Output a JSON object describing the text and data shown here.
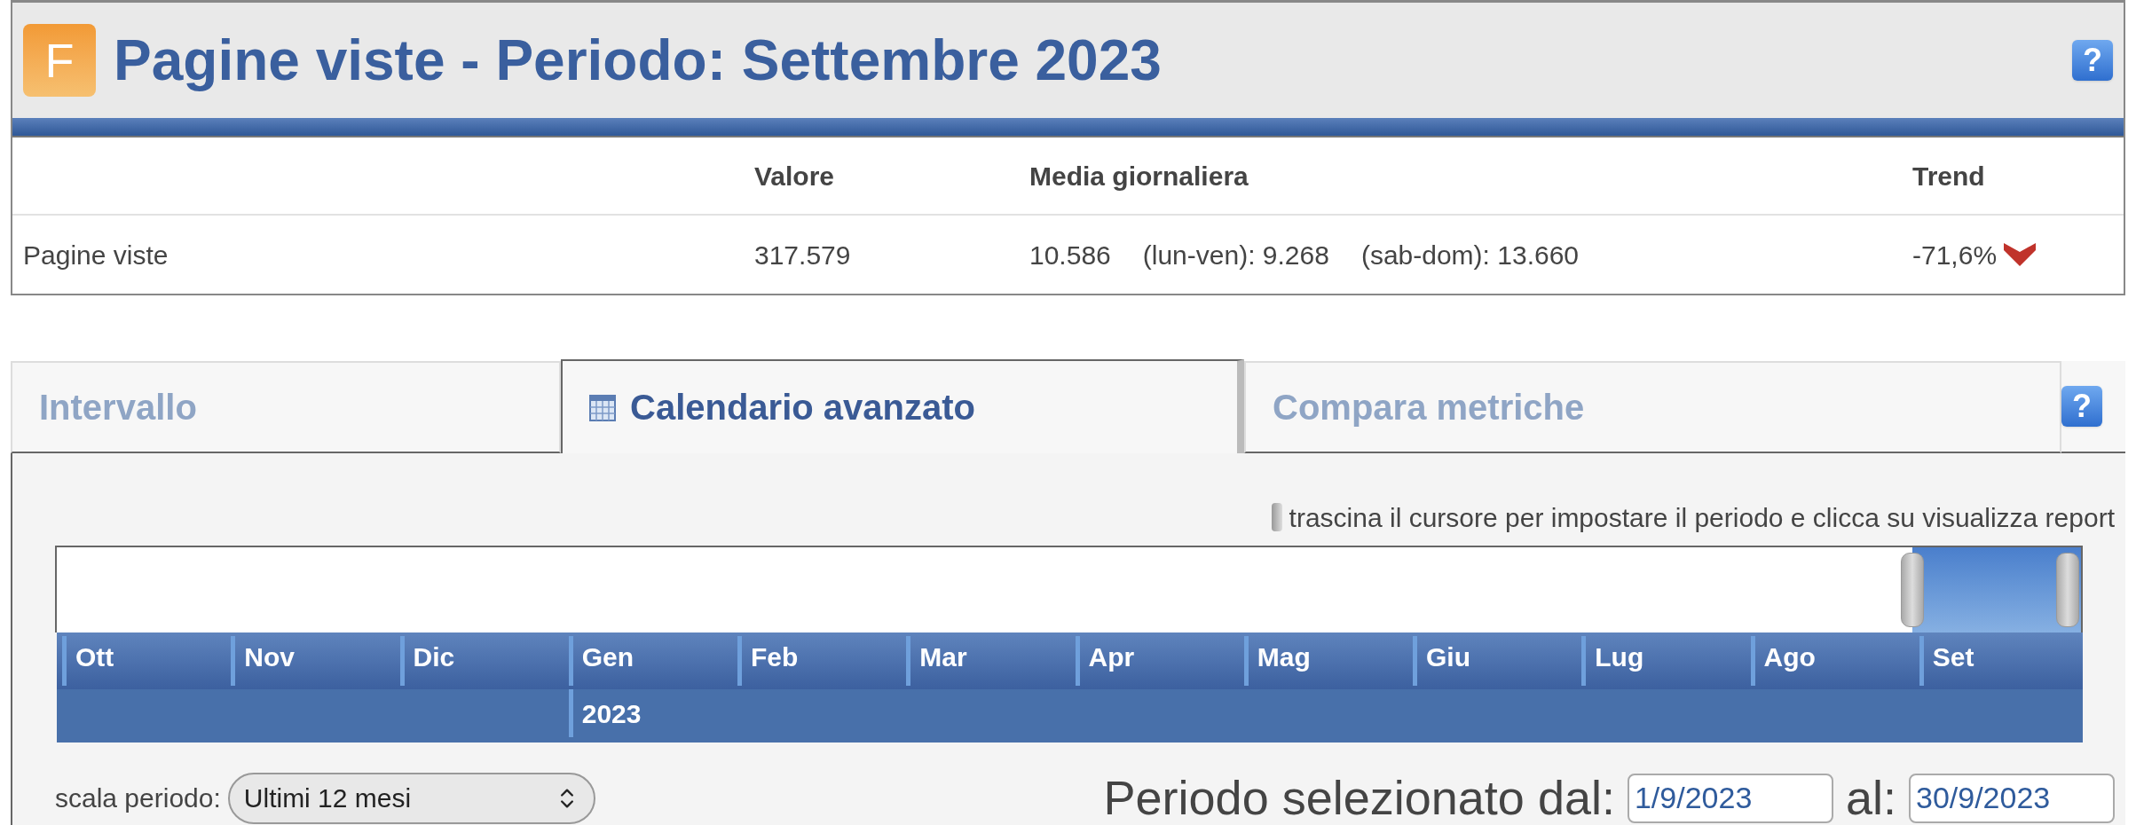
{
  "header": {
    "logo_letter": "F",
    "title": "Pagine viste - Periodo: Settembre 2023",
    "help": "?"
  },
  "table": {
    "columns": [
      "Valore",
      "Media giornaliera",
      "Trend"
    ],
    "rows": [
      {
        "label": "Pagine viste",
        "value": "317.579",
        "daily": "10.586",
        "weekday": "(lun-ven): 9.268",
        "weekend": "(sab-dom): 13.660",
        "trend": "-71,6%",
        "trend_down": true
      }
    ]
  },
  "tabs": [
    {
      "label": "Intervallo",
      "selected": false
    },
    {
      "label": "Calendario avanzato",
      "selected": true
    },
    {
      "label": "Compara metriche",
      "selected": false
    }
  ],
  "tabs_help": "?",
  "hint": "trascina il cursore per impostare il periodo e clicca su visualizza report",
  "timeline": [
    {
      "label": "Ott",
      "selected": false
    },
    {
      "label": "Nov",
      "selected": false
    },
    {
      "label": "Dic",
      "selected": false
    },
    {
      "label": "Gen",
      "year": "2023",
      "selected": false
    },
    {
      "label": "Feb",
      "selected": false
    },
    {
      "label": "Mar",
      "selected": false
    },
    {
      "label": "Apr",
      "selected": false
    },
    {
      "label": "Mag",
      "selected": false
    },
    {
      "label": "Giu",
      "selected": false
    },
    {
      "label": "Lug",
      "selected": false
    },
    {
      "label": "Ago",
      "selected": false
    },
    {
      "label": "Set",
      "selected": true
    }
  ],
  "scale": {
    "label": "scala periodo:",
    "value": "Ultimi 12 mesi"
  },
  "period": {
    "label": "Periodo selezionato dal:",
    "from": "1/9/2023",
    "to_label": "al:",
    "to": "30/9/2023"
  }
}
